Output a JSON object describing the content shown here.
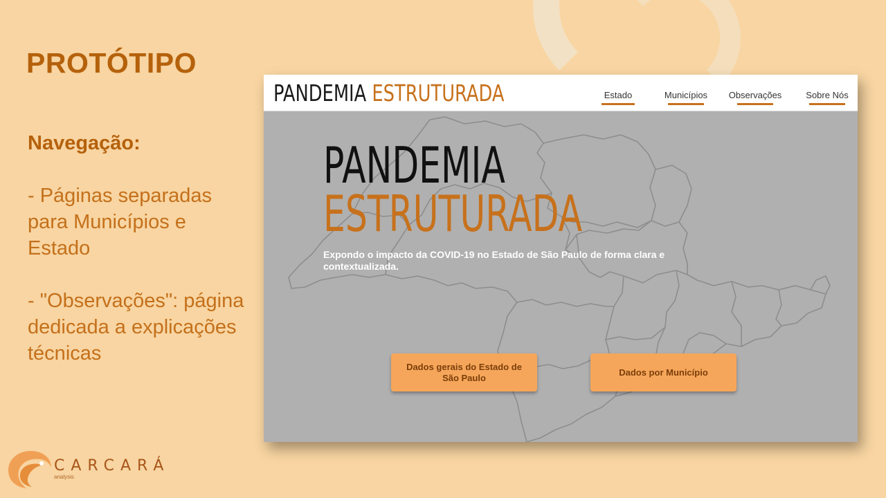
{
  "slide": {
    "title": "PROTÓTIPO",
    "nav_heading": "Navegação:",
    "bullets": [
      "- Páginas separadas para Municípios e Estado",
      "- \"Observações\": página dedicada a explicações técnicas"
    ]
  },
  "mockup": {
    "brand_part1": "PANDEMIA",
    "brand_part2": "ESTRUTURADA",
    "nav": [
      "Estado",
      "Municípios",
      "Observações",
      "Sobre Nós"
    ],
    "hero_line1": "PANDEMIA",
    "hero_line2": "ESTRUTURADA",
    "hero_subtitle": "Expondo o impacto da COVID-19 no Estado de São Paulo de forma clara e contextualizada.",
    "cta_state": "Dados gerais do Estado de São Paulo",
    "cta_municipality": "Dados por Município"
  },
  "logo": {
    "name": "CARCARÁ",
    "tagline": "analysis"
  },
  "colors": {
    "background": "#f8d5a2",
    "accent": "#c7711c",
    "title": "#b5610c",
    "button": "#f6a65a"
  }
}
